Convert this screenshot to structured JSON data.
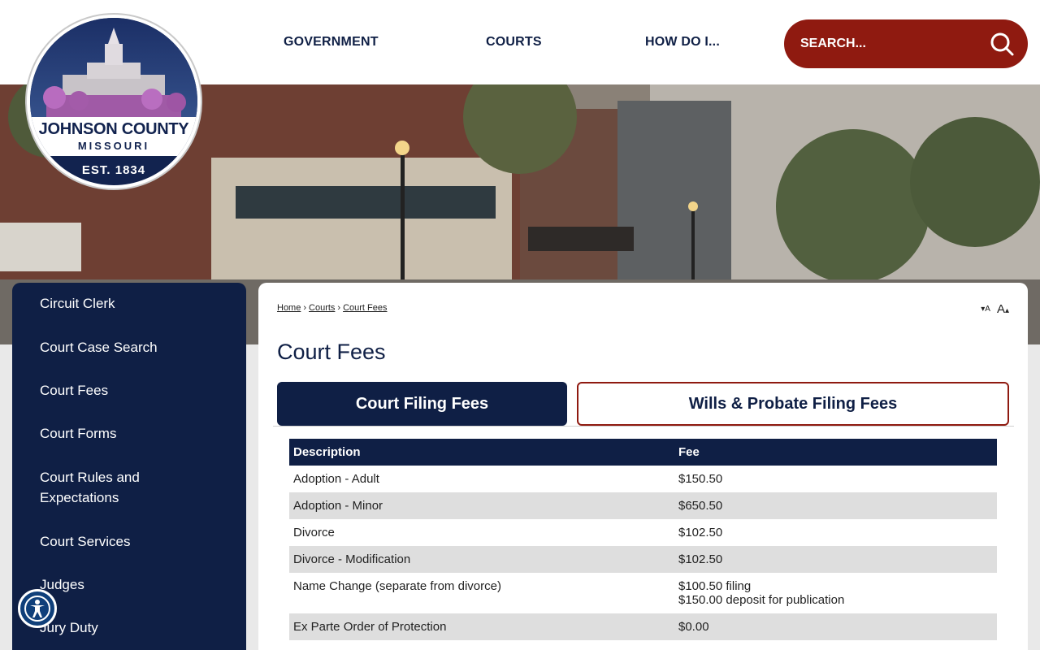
{
  "header": {
    "nav": [
      "GOVERNMENT",
      "COURTS",
      "HOW DO I..."
    ],
    "search_placeholder": "SEARCH...",
    "search_icon": "search-icon"
  },
  "logo": {
    "name": "JOHNSON COUNTY",
    "state": "MISSOURI",
    "est": "EST. 1834"
  },
  "sidebar": {
    "items": [
      "Circuit Clerk",
      "Court Case Search",
      "Court Fees",
      "Court Forms",
      "Court Rules and Expectations",
      "Court Services",
      "Judges",
      "Jury Duty"
    ]
  },
  "breadcrumb": [
    "Home",
    "Courts",
    "Court Fees"
  ],
  "font_controls": {
    "decrease": "A",
    "increase": "A"
  },
  "page_title": "Court Fees",
  "tabs": [
    {
      "label": "Court Filing Fees",
      "active": true
    },
    {
      "label": "Wills & Probate Filing Fees",
      "active": false
    }
  ],
  "table": {
    "headers": [
      "Description",
      "Fee"
    ],
    "rows": [
      {
        "description": "Adoption - Adult",
        "fee": "$150.50"
      },
      {
        "description": "Adoption - Minor",
        "fee": "$650.50"
      },
      {
        "description": "Divorce",
        "fee": "$102.50"
      },
      {
        "description": "Divorce - Modification",
        "fee": "$102.50"
      },
      {
        "description": "Name Change (separate from divorce)",
        "fee": "$100.50 filing",
        "fee_line2": "$150.00 deposit for publication"
      },
      {
        "description": "Ex Parte Order of Protection",
        "fee": "$0.00"
      }
    ]
  },
  "colors": {
    "navy": "#0f1f45",
    "search_red": "#8f1a10",
    "row_alt": "#dedede"
  }
}
